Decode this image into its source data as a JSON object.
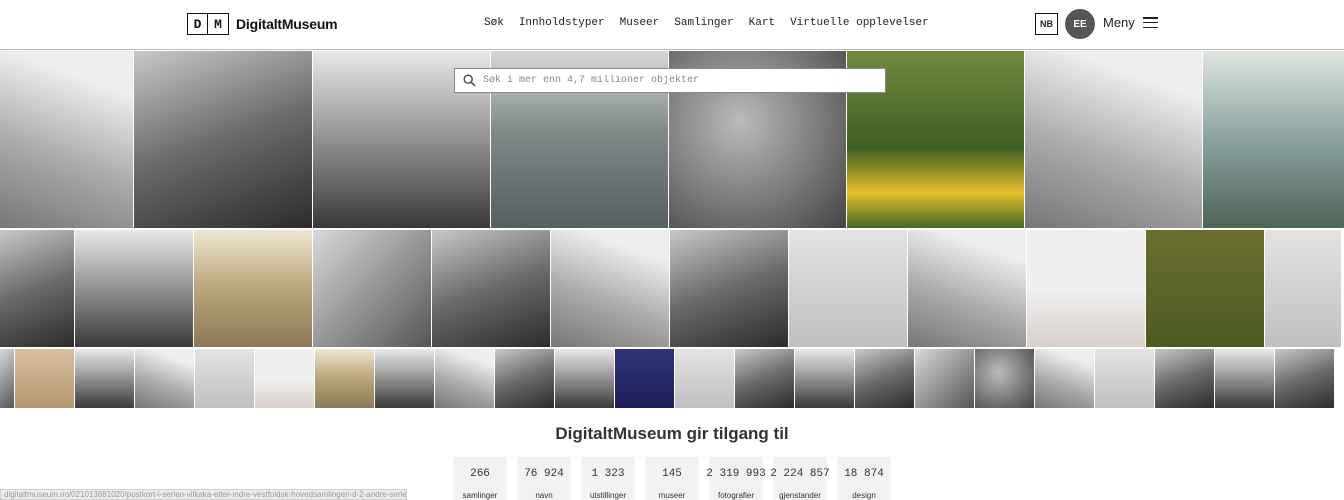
{
  "brand": {
    "logo_d": "D",
    "logo_m": "M",
    "name": "DigitaltMuseum"
  },
  "nav": {
    "items": [
      "Søk",
      "Innholdstyper",
      "Museer",
      "Samlinger",
      "Kart",
      "Virtuelle opplevelser"
    ]
  },
  "header": {
    "language": "NB",
    "user_initials": "EE",
    "menu_label": "Meny"
  },
  "search": {
    "placeholder": "Søk i mer enn 4,7 millioner objekter",
    "value": ""
  },
  "stats": {
    "title": "DigitaltMuseum gir tilgang til",
    "items": [
      {
        "value": "266",
        "label": "samlinger"
      },
      {
        "value": "76 924",
        "label": "navn"
      },
      {
        "value": "1 323",
        "label": "utstillinger"
      },
      {
        "value": "145",
        "label": "museer"
      },
      {
        "value": "2 319 993",
        "label": "fotografier"
      },
      {
        "value": "2 224 857",
        "label": "gjenstander"
      },
      {
        "value": "18 874",
        "label": "design"
      }
    ]
  },
  "status_bar": {
    "url": "digitaltmuseum.no/021013881020/postkort-i-serien-vilkaka-etter-indre-vestfoldsk-hovedsamlingen-d-2-andre-serie"
  },
  "colors": {
    "accent_dark": "#555555",
    "stat_bg": "#f2f2f2",
    "border": "#bbbbbb"
  }
}
